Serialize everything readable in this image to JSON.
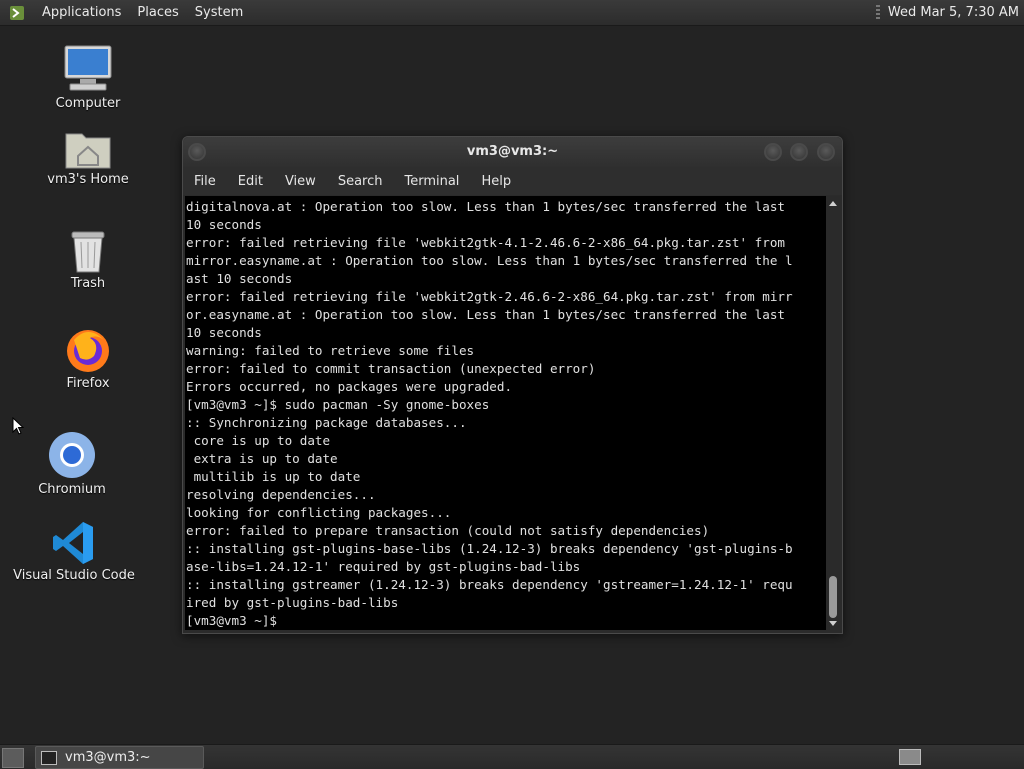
{
  "top_panel": {
    "menus": [
      "Applications",
      "Places",
      "System"
    ],
    "clock": "Wed Mar 5,  7:30 AM"
  },
  "desktop_icons": [
    {
      "label": "Computer",
      "icon": "computer-icon"
    },
    {
      "label": "vm3's Home",
      "icon": "home-folder-icon"
    },
    {
      "label": "Trash",
      "icon": "trash-icon"
    },
    {
      "label": "Firefox",
      "icon": "firefox-icon"
    },
    {
      "label": "Chromium",
      "icon": "chromium-icon"
    },
    {
      "label": "Visual Studio Code",
      "icon": "vscode-icon"
    }
  ],
  "terminal": {
    "title": "vm3@vm3:~",
    "menu": [
      "File",
      "Edit",
      "View",
      "Search",
      "Terminal",
      "Help"
    ],
    "lines": [
      "digitalnova.at : Operation too slow. Less than 1 bytes/sec transferred the last",
      "10 seconds",
      "error: failed retrieving file 'webkit2gtk-4.1-2.46.6-2-x86_64.pkg.tar.zst' from",
      "mirror.easyname.at : Operation too slow. Less than 1 bytes/sec transferred the l",
      "ast 10 seconds",
      "error: failed retrieving file 'webkit2gtk-2.46.6-2-x86_64.pkg.tar.zst' from mirr",
      "or.easyname.at : Operation too slow. Less than 1 bytes/sec transferred the last",
      "10 seconds",
      "warning: failed to retrieve some files",
      "error: failed to commit transaction (unexpected error)",
      "Errors occurred, no packages were upgraded.",
      "[vm3@vm3 ~]$ sudo pacman -Sy gnome-boxes",
      ":: Synchronizing package databases...",
      " core is up to date",
      " extra is up to date",
      " multilib is up to date",
      "resolving dependencies...",
      "looking for conflicting packages...",
      "error: failed to prepare transaction (could not satisfy dependencies)",
      ":: installing gst-plugins-base-libs (1.24.12-3) breaks dependency 'gst-plugins-b",
      "ase-libs=1.24.12-1' required by gst-plugins-bad-libs",
      ":: installing gstreamer (1.24.12-3) breaks dependency 'gstreamer=1.24.12-1' requ",
      "ired by gst-plugins-bad-libs",
      "[vm3@vm3 ~]$ "
    ]
  },
  "bottom_panel": {
    "task_label": "vm3@vm3:~"
  }
}
